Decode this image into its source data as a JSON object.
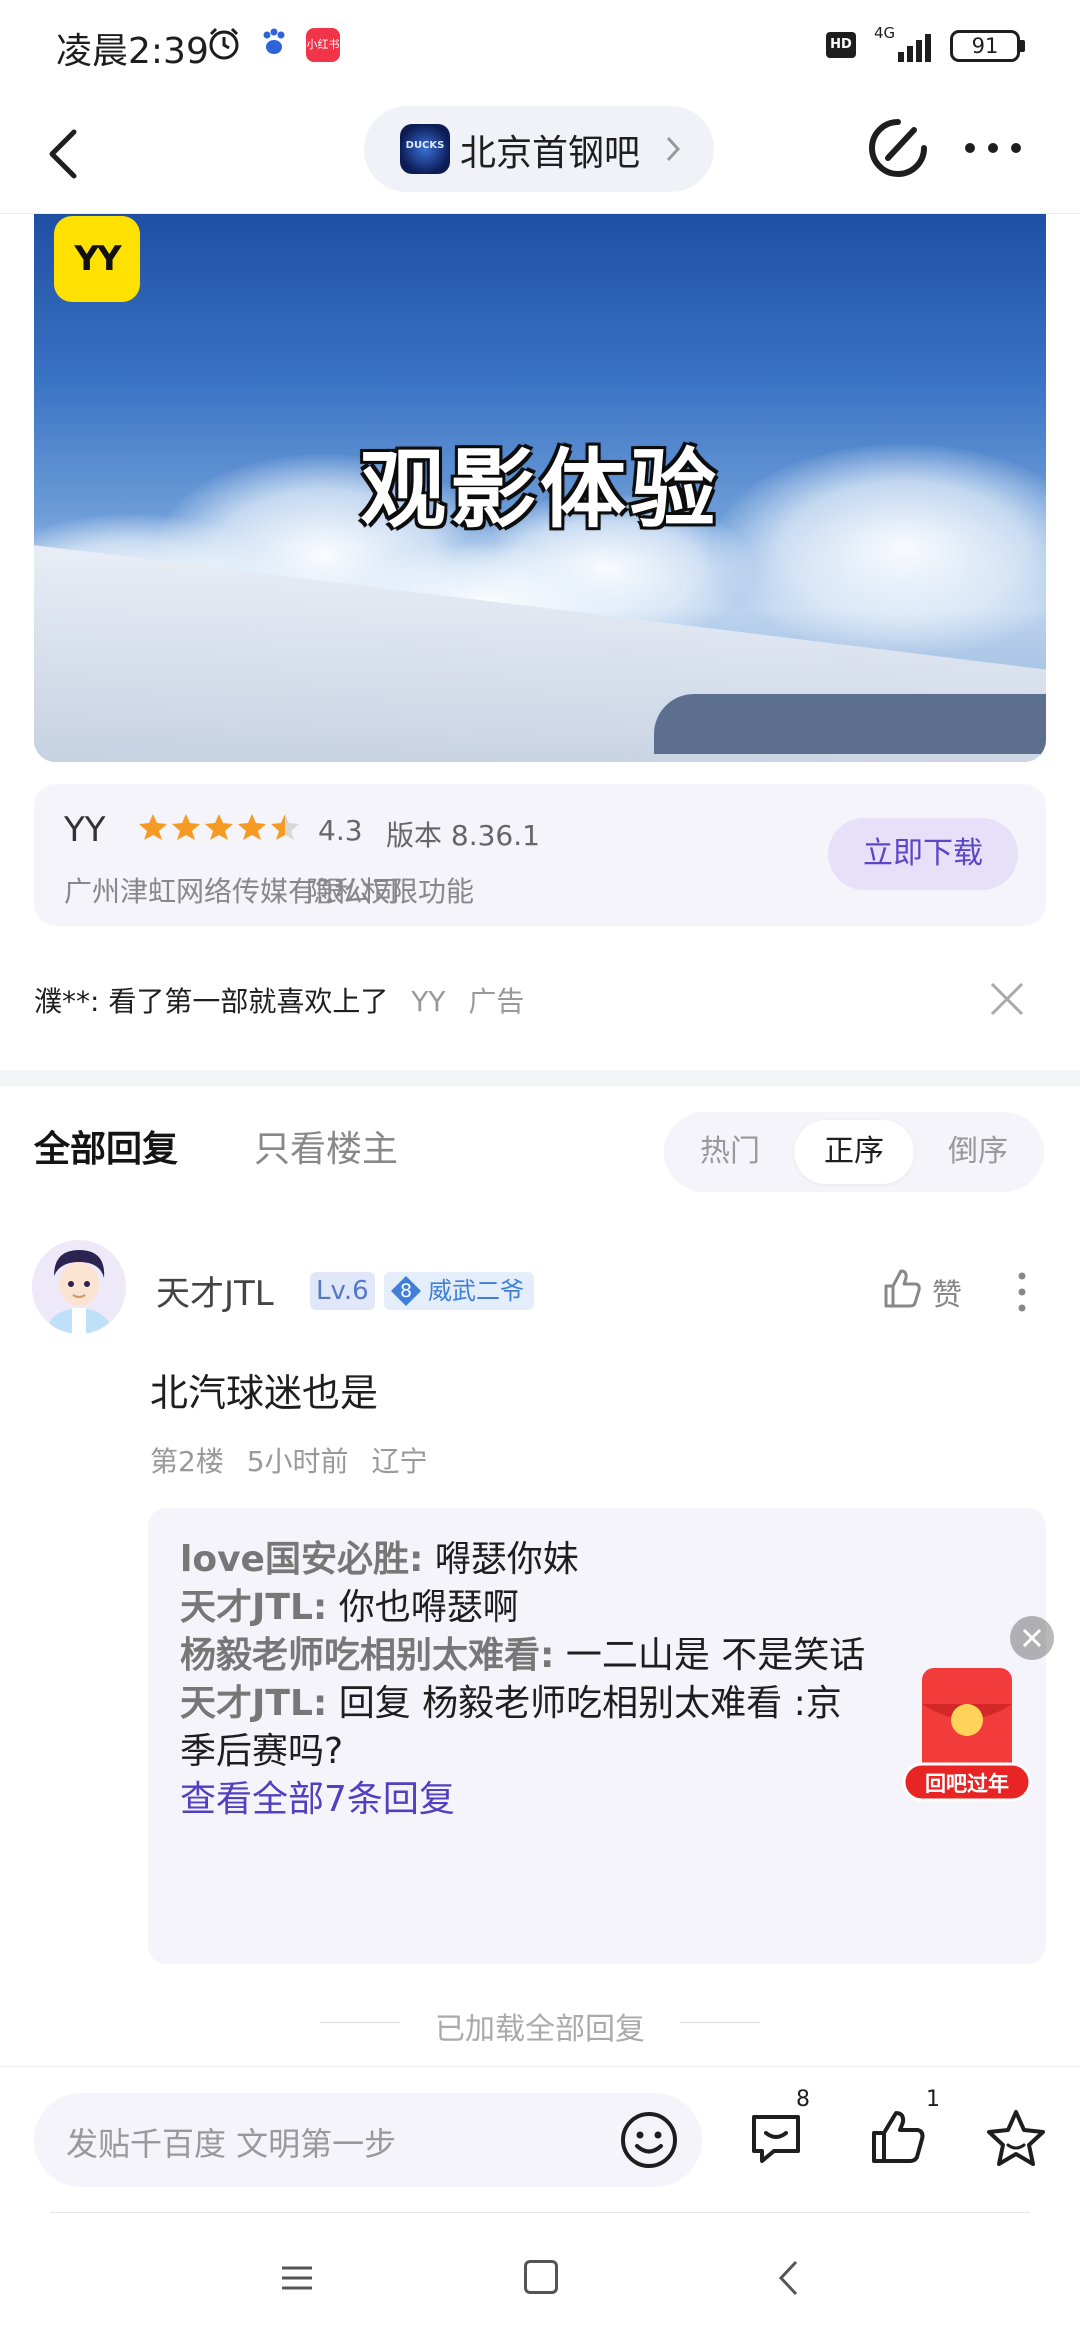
{
  "status_bar": {
    "time": "凌晨2:39",
    "app_badge": "小红书",
    "hd_label": "HD",
    "network": "4G",
    "battery": "91"
  },
  "header": {
    "forum_name": "北京首钢吧",
    "forum_logo_text": "DUCKS"
  },
  "ad": {
    "caption": "观影体验",
    "logo_text": "YY",
    "app_name": "YY",
    "rating": "4.3",
    "rating_value": 4.3,
    "version": "版本 8.36.1",
    "developer": "广州津虹网络传媒有限公司",
    "links": [
      "隐私",
      "权限",
      "功能"
    ],
    "download_label": "立即下载",
    "source_text": "濮**: 看了第一部就喜欢上了",
    "source_app": "YY",
    "ad_label": "广告"
  },
  "tabs": {
    "all_replies": "全部回复",
    "owner_only": "只看楼主",
    "sort_options": [
      "热门",
      "正序",
      "倒序"
    ],
    "selected_sort": "正序"
  },
  "reply": {
    "author": "天才JTL",
    "level": "Lv.6",
    "title_level": "8",
    "title": "威武二爷",
    "like_label": "赞",
    "body": "北汽球迷也是",
    "floor": "第2楼",
    "time": "5小时前",
    "location": "辽宁",
    "subreplies": [
      {
        "who": "love国安必胜:",
        "text": " 嘚瑟你妹"
      },
      {
        "who": "天才JTL:",
        "text": " 你也嘚瑟啊"
      },
      {
        "who": "杨毅老师吃相别太难看:",
        "text": " 一二山是 不是笑话"
      },
      {
        "who": "天才JTL:",
        "text": " 回复 杨毅老师吃相别太难看 :京"
      }
    ],
    "subreply_continuation": "季后赛吗?",
    "view_all": "查看全部7条回复"
  },
  "loaded_all": "已加载全部回复",
  "promo": {
    "label": "回吧过年"
  },
  "bottom_bar": {
    "compose_placeholder": "发贴千百度 文明第一步",
    "comment_count": "8",
    "like_count": "1"
  },
  "colors": {
    "accent": "#5b46c7",
    "link": "#5140c0",
    "star": "#f59b23",
    "promo_red": "#f23b3b"
  }
}
